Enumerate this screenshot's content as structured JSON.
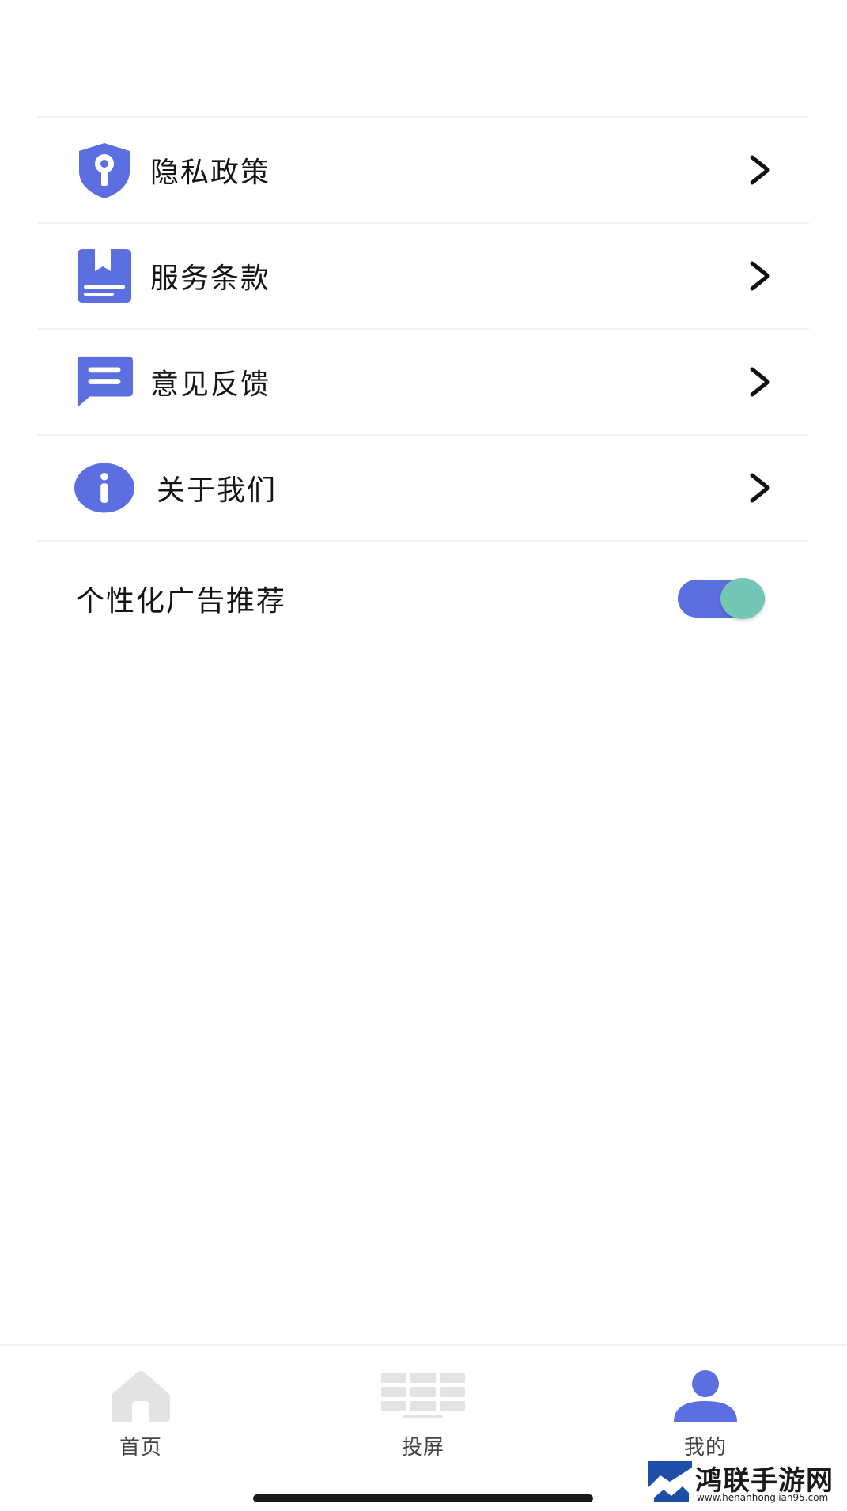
{
  "menu": {
    "items": [
      {
        "label": "隐私政策",
        "icon": "shield-key-icon"
      },
      {
        "label": "服务条款",
        "icon": "bookmark-document-icon"
      },
      {
        "label": "意见反馈",
        "icon": "chat-bubble-icon"
      },
      {
        "label": "关于我们",
        "icon": "info-icon"
      }
    ]
  },
  "personalized_ads": {
    "label": "个性化广告推荐",
    "enabled": true
  },
  "tabbar": {
    "tabs": [
      {
        "label": "首页",
        "icon": "home-icon",
        "active": false
      },
      {
        "label": "投屏",
        "icon": "screen-cast-icon",
        "active": false
      },
      {
        "label": "我的",
        "icon": "user-icon",
        "active": true
      }
    ]
  },
  "watermark": {
    "name": "鸿联手游网",
    "url": "www.henanhonglian95.com"
  },
  "colors": {
    "accent": "#5b6fe0",
    "switch_knob": "#74c6b5",
    "inactive_icon": "#e3e3e3"
  }
}
